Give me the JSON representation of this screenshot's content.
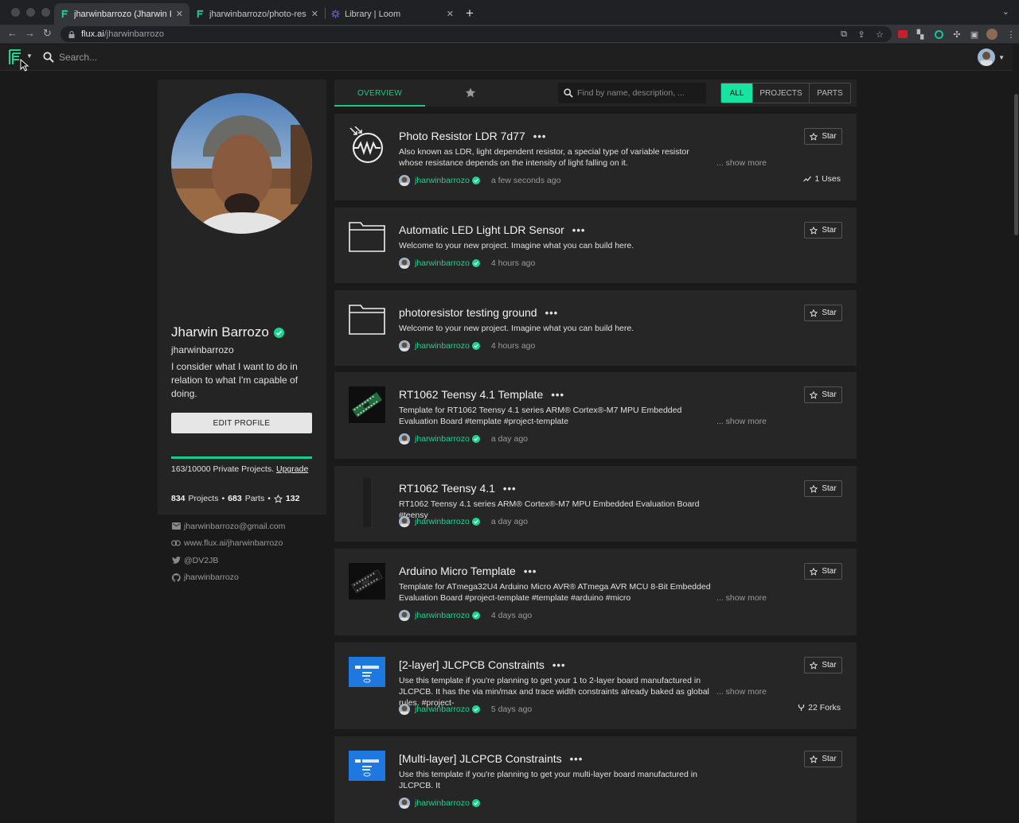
{
  "browser": {
    "tabs": [
      {
        "title": "jharwinbarrozo (Jharwin Barrozo)",
        "active": true
      },
      {
        "title": "jharwinbarrozo/photo-resistor-ldr",
        "active": false
      },
      {
        "title": "Library | Loom",
        "active": false
      }
    ],
    "url_host": "flux.ai",
    "url_path": "/jharwinbarrozo"
  },
  "app": {
    "search_placeholder": "Search...",
    "accent": "#19d492"
  },
  "profile": {
    "name": "Jharwin Barrozo",
    "username": "jharwinbarrozo",
    "bio": "I consider what I want to do in relation to what I'm capable of doing.",
    "edit_label": "EDIT PROFILE",
    "quota_used": 163,
    "quota_total": 10000,
    "quota_text": "163/10000 Private Projects.",
    "upgrade_label": "Upgrade",
    "projects_count": "834",
    "projects_label": "Projects",
    "parts_count": "683",
    "parts_label": "Parts",
    "stars_count": "132",
    "email": "jharwinbarrozo@gmail.com",
    "website": "www.flux.ai/jharwinbarrozo",
    "twitter": "@DV2JB",
    "github": "jharwinbarrozo"
  },
  "filter": {
    "overview_label": "OVERVIEW",
    "search_placeholder": "Find by name, description, ...",
    "seg_all": "ALL",
    "seg_projects": "PROJECTS",
    "seg_parts": "PARTS",
    "selected": "ALL"
  },
  "cards": [
    {
      "title": "Photo Resistor LDR 7d77",
      "desc": "Also known as LDR, light dependent resistor, a special type of variable resistor whose resistance depends on the intensity of light falling on it.",
      "author": "jharwinbarrozo",
      "time": "a few seconds ago",
      "show_more": "... show more",
      "stat": "1 Uses",
      "thumb": "ldr-symbol"
    },
    {
      "title": "Automatic LED Light LDR Sensor",
      "desc": "Welcome to your new project. Imagine what you can build here.",
      "author": "jharwinbarrozo",
      "time": "4 hours ago",
      "thumb": "folder"
    },
    {
      "title": "photoresistor testing ground",
      "desc": "Welcome to your new project. Imagine what you can build here.",
      "author": "jharwinbarrozo",
      "time": "4 hours ago",
      "thumb": "folder"
    },
    {
      "title": "RT1062 Teensy 4.1 Template",
      "desc": "Template for RT1062 Teensy 4.1 series ARM® Cortex®-M7 MPU Embedded Evaluation Board #template #project-template",
      "author": "jharwinbarrozo",
      "time": "a day ago",
      "show_more": "... show more",
      "thumb": "pcb-green"
    },
    {
      "title": "RT1062 Teensy 4.1",
      "desc": "RT1062 Teensy 4.1 series ARM® Cortex®-M7 MPU Embedded Evaluation Board #teensy",
      "author": "jharwinbarrozo",
      "time": "a day ago",
      "thumb": "pcb-dark"
    },
    {
      "title": "Arduino Micro Template",
      "desc": "Template for ATmega32U4 Arduino Micro AVR® ATmega AVR MCU 8-Bit Embedded Evaluation Board #project-template #template #arduino #micro",
      "author": "jharwinbarrozo",
      "time": "4 days ago",
      "show_more": "... show more",
      "thumb": "pcb-black"
    },
    {
      "title": "[2-layer] JLCPCB Constraints",
      "desc": "Use this template if you're planning to get your 1 to 2-layer board manufactured in JLCPCB. It has the via min/max and trace width constraints already baked as global rules. #project-",
      "author": "jharwinbarrozo",
      "time": "5 days ago",
      "show_more": "... show more",
      "stat": "22 Forks",
      "thumb": "jlcpcb"
    },
    {
      "title": "[Multi-layer] JLCPCB Constraints",
      "desc": "Use this template if you're planning to get your multi-layer board manufactured in JLCPCB. It",
      "author": "jharwinbarrozo",
      "time": "",
      "thumb": "jlcpcb"
    }
  ],
  "star_label": "Star"
}
